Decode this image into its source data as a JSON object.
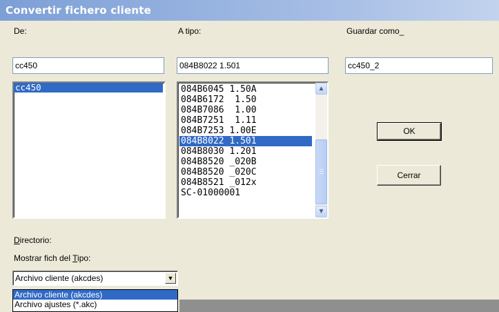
{
  "window": {
    "title": "Convertir fichero cliente"
  },
  "labels": {
    "de": "De:",
    "a_tipo": "A tipo:",
    "guardar_como": "Guardar como_",
    "directorio_prefix": "D",
    "directorio_rest": "irectorio:",
    "mostrar_prefix": "Mostrar fich del ",
    "mostrar_u": "T",
    "mostrar_rest": "ipo:"
  },
  "inputs": {
    "de_value": "cc450",
    "a_tipo_value": "084B8022 1.501",
    "guardar_value": "cc450_2"
  },
  "source_list": {
    "items": [
      "cc450"
    ],
    "selected": 0
  },
  "type_list": {
    "items": [
      "084B6045 1.50A",
      "084B6172  1.50",
      "084B7086  1.00",
      "084B7251  1.11",
      "084B7253 1.00E",
      "084B8022 1.501",
      "084B8030 1.201",
      "084B8520 _020B",
      "084B8520 _020C",
      "084B8521 _012x",
      "SC-01000001"
    ],
    "selected": 5
  },
  "buttons": {
    "ok": "OK",
    "cerrar": "Cerrar"
  },
  "file_type": {
    "selected": "Archivo cliente (akcdes)",
    "options": [
      "Archivo cliente (akcdes)",
      "Archivo ajustes (*.akc)"
    ],
    "selected_index": 0
  },
  "icons": {
    "scroll_up": "chevron-up-icon",
    "scroll_down": "chevron-down-icon",
    "dropdown": "dropdown-arrow-icon"
  }
}
